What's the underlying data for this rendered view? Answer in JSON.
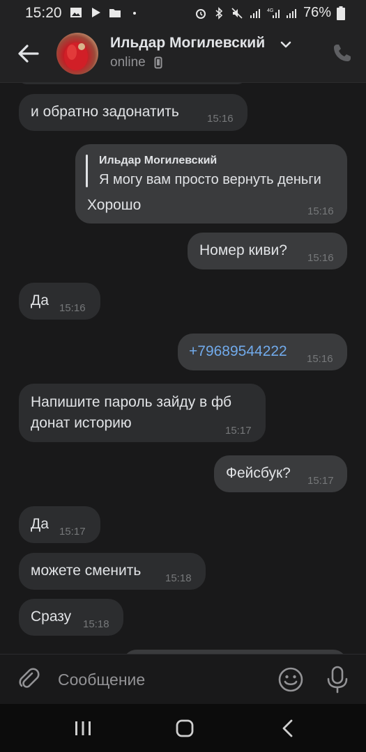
{
  "status_bar": {
    "time": "15:20",
    "battery": "76%",
    "network": "4G"
  },
  "header": {
    "contact_name": "Ильдар Могилевский",
    "status": "online"
  },
  "messages": [
    {
      "direction": "in",
      "text": "и обратно задонатить",
      "time": "15:16"
    },
    {
      "direction": "out",
      "reply_author": "Ильдар Могилевский",
      "reply_text": "Я могу вам просто вернуть деньги",
      "text": "Хорошо",
      "time": "15:16"
    },
    {
      "direction": "out",
      "text": "Номер киви?",
      "time": "15:16"
    },
    {
      "direction": "in",
      "text": "Да",
      "time": "15:16"
    },
    {
      "direction": "out",
      "text": "+79689544222",
      "time": "15:16",
      "is_link": true
    },
    {
      "direction": "in",
      "text_line1": "Напишите пароль зайду в фб",
      "text_line2": "донат историю",
      "time": "15:17"
    },
    {
      "direction": "out",
      "text": "Фейсбук?",
      "time": "15:17"
    },
    {
      "direction": "in",
      "text": "Да",
      "time": "15:17"
    },
    {
      "direction": "in",
      "text": "можете сменить",
      "time": "15:18"
    },
    {
      "direction": "in",
      "text": "Сразу",
      "time": "15:18"
    }
  ],
  "composer": {
    "placeholder": "Сообщение"
  },
  "icons": {
    "back": "arrow-left-icon",
    "call": "phone-icon",
    "attach": "paperclip-icon",
    "emoji": "smiley-icon",
    "mic": "microphone-icon"
  },
  "colors": {
    "background": "#19191a",
    "bubble_in": "#2c2d2f",
    "bubble_out": "#3a3b3d",
    "link": "#71aaeb"
  }
}
